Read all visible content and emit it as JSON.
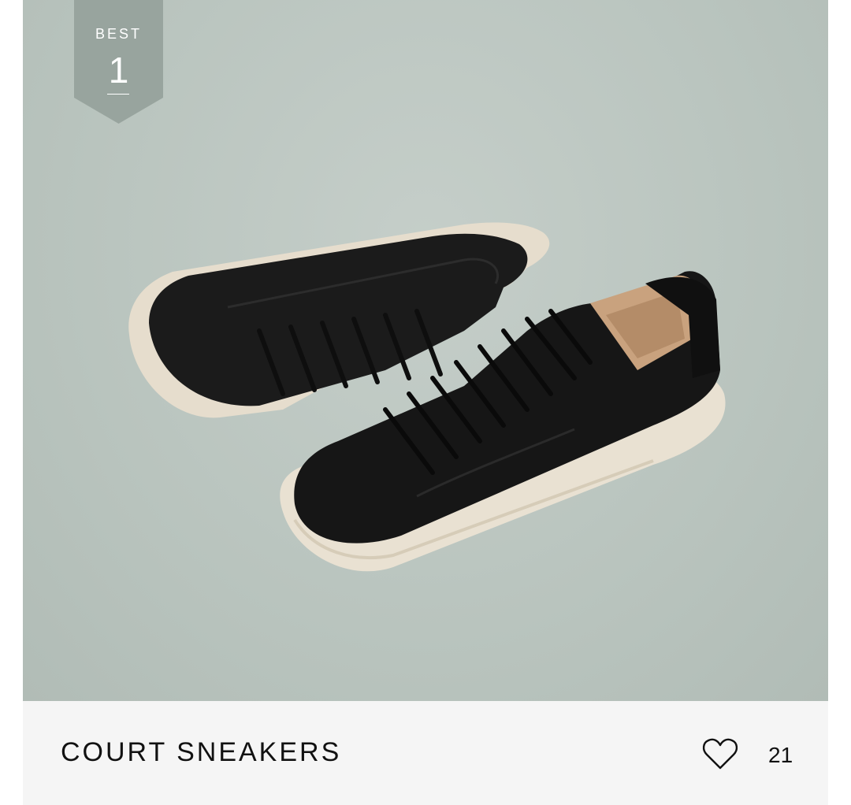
{
  "product": {
    "name": "COURT SNEAKERS",
    "image_alt": "Black leather low-top court sneakers with cream soles"
  },
  "badge": {
    "label": "BEST",
    "rank": "1",
    "color": "#98a49e"
  },
  "likes": {
    "icon": "heart-outline-icon",
    "count": "21"
  },
  "colors": {
    "photo_background": "#bcc6c1",
    "info_background": "#f5f5f5",
    "text": "#111111"
  }
}
